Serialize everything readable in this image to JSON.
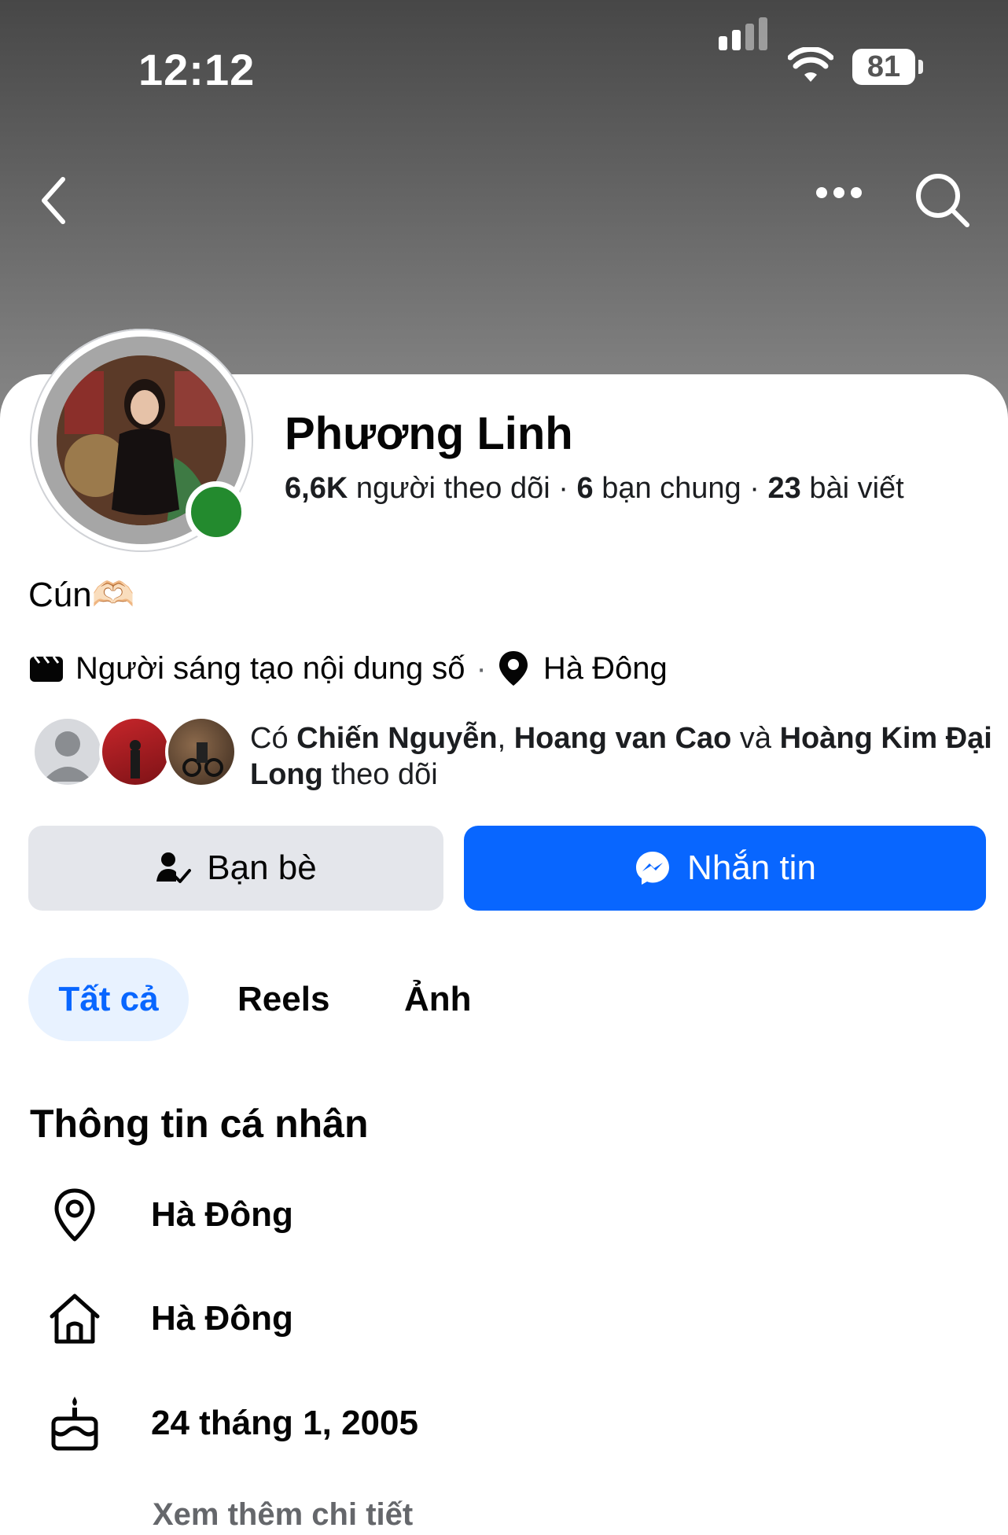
{
  "status_bar": {
    "time": "12:12",
    "battery": "81"
  },
  "profile": {
    "name": "Phương Linh",
    "followers_count": "6,6K",
    "followers_label": "người theo dõi",
    "mutual_count": "6",
    "mutual_label": "bạn chung",
    "posts_count": "23",
    "posts_label": "bài viết",
    "bio": "Cún🫶🏻",
    "category": "Người sáng tạo nội dung số",
    "location": "Hà Đông"
  },
  "followed_by": {
    "prefix": "Có",
    "name1": "Chiến Nguyễn",
    "comma": ",",
    "name2": "Hoang van Cao",
    "and": "và",
    "name3": "Hoàng Kim Đại Long",
    "suffix": "theo dõi"
  },
  "actions": {
    "friends_label": "Bạn bè",
    "message_label": "Nhắn tin"
  },
  "tabs": [
    {
      "label": "Tất cả"
    },
    {
      "label": "Reels"
    },
    {
      "label": "Ảnh"
    }
  ],
  "personal_info": {
    "title": "Thông tin cá nhân",
    "current_city": "Hà Đông",
    "hometown": "Hà Đông",
    "birthday": "24 tháng 1, 2005",
    "see_more": "Xem thêm chi tiết"
  },
  "colors": {
    "accent": "#0866ff",
    "online": "#238a2e",
    "button_gray": "#e4e6eb"
  }
}
